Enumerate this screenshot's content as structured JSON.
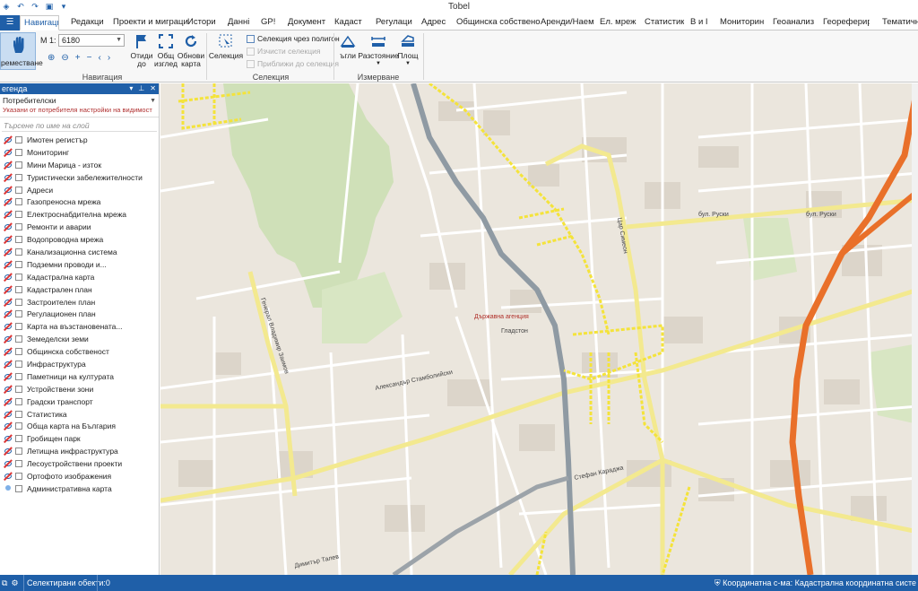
{
  "window": {
    "title": "Tobel"
  },
  "tabs": [
    {
      "label": "Навигаци",
      "active": true
    },
    {
      "label": "Редакци"
    },
    {
      "label": "Проекти и миграци"
    },
    {
      "label": "Истори"
    },
    {
      "label": "Данні"
    },
    {
      "label": "GP!"
    },
    {
      "label": "Документ"
    },
    {
      "label": "Кадаст"
    },
    {
      "label": "Регулаци"
    },
    {
      "label": "Адрес"
    },
    {
      "label": "Общинска собствено"
    },
    {
      "label": "Аренди/Наем"
    },
    {
      "label": "Ел. мреж"
    },
    {
      "label": "Статистик"
    },
    {
      "label": "В и I"
    },
    {
      "label": "Мониторин"
    },
    {
      "label": "Геоанализ"
    },
    {
      "label": "Георефериран"
    },
    {
      "label": "Тематични"
    }
  ],
  "ribbon": {
    "pan_label": "реместване",
    "scale_label": "M 1:",
    "scale_value": "6180",
    "goto_label_1": "Отиди",
    "goto_label_2": "до",
    "overview_label_1": "Общ",
    "overview_label_2": "изглед",
    "refresh_label_1": "Обнови",
    "refresh_label_2": "карта",
    "navigation_group": "Навигация",
    "selection_label": "Селекция",
    "select_polygon": "Селекция чрез полигон",
    "clear_selection": "Изчисти селекция",
    "zoom_selection": "Приближи до селекция",
    "selection_group": "Селекция",
    "angles_label": "ъгли",
    "distance_label": "Разстояние",
    "area_label": "Площ",
    "measure_group": "Измерване"
  },
  "legend": {
    "title": "егенда",
    "profile_name": "Потребителски",
    "profile_sub": "Указани от потребителя настройки на видимост",
    "search_placeholder": "Търсене по име на слой",
    "layers": [
      {
        "label": "Имотен регистър",
        "icon": "hidden-eye-icon"
      },
      {
        "label": "Мониторинг",
        "icon": "hidden-eye-icon"
      },
      {
        "label": "Мини Марица - изток",
        "icon": "hidden-eye-icon"
      },
      {
        "label": "Туристически забележителности",
        "icon": "hidden-eye-icon"
      },
      {
        "label": "Адреси",
        "icon": "hidden-eye-icon"
      },
      {
        "label": "Газопреносна мрежа",
        "icon": "hidden-eye-icon"
      },
      {
        "label": "Електроснабдителна мрежа",
        "icon": "hidden-eye-icon"
      },
      {
        "label": "Ремонти и аварии",
        "icon": "hidden-eye-icon"
      },
      {
        "label": "Водопроводна мрежа",
        "icon": "hidden-eye-icon"
      },
      {
        "label": "Канализационна система",
        "icon": "hidden-eye-icon"
      },
      {
        "label": "Подземни проводи и...",
        "icon": "hidden-eye-icon"
      },
      {
        "label": "Кадастрална карта",
        "icon": "hidden-eye-icon"
      },
      {
        "label": "Кадастрален план",
        "icon": "hidden-eye-icon"
      },
      {
        "label": "Застроителен план",
        "icon": "hidden-eye-icon"
      },
      {
        "label": "Регулационен план",
        "icon": "hidden-eye-icon"
      },
      {
        "label": "Карта на възстановената...",
        "icon": "hidden-eye-icon"
      },
      {
        "label": "Земеделски земи",
        "icon": "hidden-eye-icon"
      },
      {
        "label": "Общинска собственост",
        "icon": "hidden-eye-icon"
      },
      {
        "label": "Инфраструктура",
        "icon": "hidden-eye-icon"
      },
      {
        "label": "Паметници на културата",
        "icon": "hidden-eye-icon"
      },
      {
        "label": "Устройствени зони",
        "icon": "hidden-eye-icon"
      },
      {
        "label": "Градски транспорт",
        "icon": "hidden-eye-icon"
      },
      {
        "label": "Статистика",
        "icon": "hidden-eye-icon"
      },
      {
        "label": "Обща карта на България",
        "icon": "hidden-eye-icon"
      },
      {
        "label": "Гробищен парк",
        "icon": "hidden-eye-icon"
      },
      {
        "label": "Летищна инфраструктура",
        "icon": "hidden-eye-icon"
      },
      {
        "label": "Лесоустройствени проекти",
        "icon": "hidden-eye-icon"
      },
      {
        "label": "Ортофото изображения",
        "icon": "hidden-eye-icon"
      },
      {
        "label": "Административна карта",
        "icon": "bulb-icon"
      }
    ]
  },
  "map": {
    "labels": {
      "street_1": "бул. Руски",
      "street_2": "Александър Стамболийски",
      "street_3": "Генерал Владимир Заимов",
      "street_4": "Стефан Караджа",
      "street_5": "Цар Симеон",
      "street_6": "бул. Руски",
      "street_7": "Димитър Талев",
      "place_1": "Държавна агенция",
      "street_8": "Гладстон"
    },
    "colors": {
      "land": "#ebe6dd",
      "park": "#cfe0b8",
      "road": "#ffffff",
      "major_road": "#f3e98f",
      "highway": "#e9702a",
      "rail": "#8f9aa3",
      "highlight": "#f4e33a"
    }
  },
  "status": {
    "selected_objects": "Селектирани обекти:0",
    "coord_system": "Координатна с-ма: Кадастрална координатна систе"
  }
}
